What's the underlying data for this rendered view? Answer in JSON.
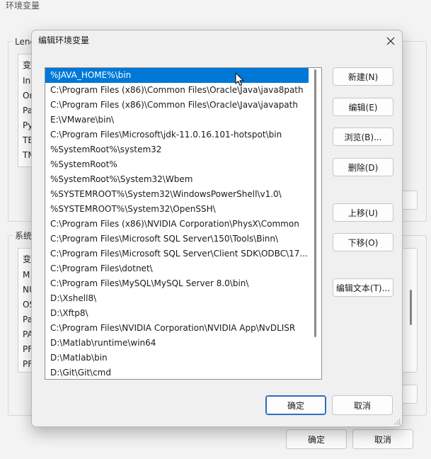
{
  "background_window": {
    "title": "环境变量",
    "user_group_label": "Lenc",
    "user_list_header": "变",
    "user_vars": [
      "In",
      "Or",
      "Pa",
      "Py",
      "TE",
      "TM"
    ],
    "system_group_label": "系统",
    "system_list_header": "变",
    "system_vars": [
      "M",
      "NU",
      "OS",
      "Pa",
      "PA",
      "PF",
      "PF"
    ],
    "ok_label": "确定",
    "cancel_label": "取消"
  },
  "dialog": {
    "title": "编辑环境变量",
    "close_icon": "close-icon",
    "paths": [
      "%JAVA_HOME%\\bin",
      "C:\\Program Files (x86)\\Common Files\\Oracle\\Java\\java8path",
      "C:\\Program Files (x86)\\Common Files\\Oracle\\Java\\javapath",
      "E:\\VMware\\bin\\",
      "C:\\Program Files\\Microsoft\\jdk-11.0.16.101-hotspot\\bin",
      "%SystemRoot%\\system32",
      "%SystemRoot%",
      "%SystemRoot%\\System32\\Wbem",
      "%SYSTEMROOT%\\System32\\WindowsPowerShell\\v1.0\\",
      "%SYSTEMROOT%\\System32\\OpenSSH\\",
      "C:\\Program Files (x86)\\NVIDIA Corporation\\PhysX\\Common",
      "C:\\Program Files\\Microsoft SQL Server\\150\\Tools\\Binn\\",
      "C:\\Program Files\\Microsoft SQL Server\\Client SDK\\ODBC\\17...",
      "C:\\Program Files\\dotnet\\",
      "C:\\Program Files\\MySQL\\MySQL Server 8.0\\bin\\",
      "D:\\Xshell8\\",
      "D:\\Xftp8\\",
      "C:\\Program Files\\NVIDIA Corporation\\NVIDIA App\\NvDLISR",
      "D:\\Matlab\\runtime\\win64",
      "D:\\Matlab\\bin",
      "D:\\Git\\Git\\cmd"
    ],
    "selected_index": 0,
    "buttons": {
      "new": "新建(N)",
      "edit": "编辑(E)",
      "browse": "浏览(B)...",
      "delete": "删除(D)",
      "move_up": "上移(U)",
      "move_down": "下移(O)",
      "edit_text": "编辑文本(T)..."
    },
    "ok_label": "确定",
    "cancel_label": "取消"
  },
  "colors": {
    "selection": "#0078d7",
    "default_button_border": "#2b6fbd"
  }
}
